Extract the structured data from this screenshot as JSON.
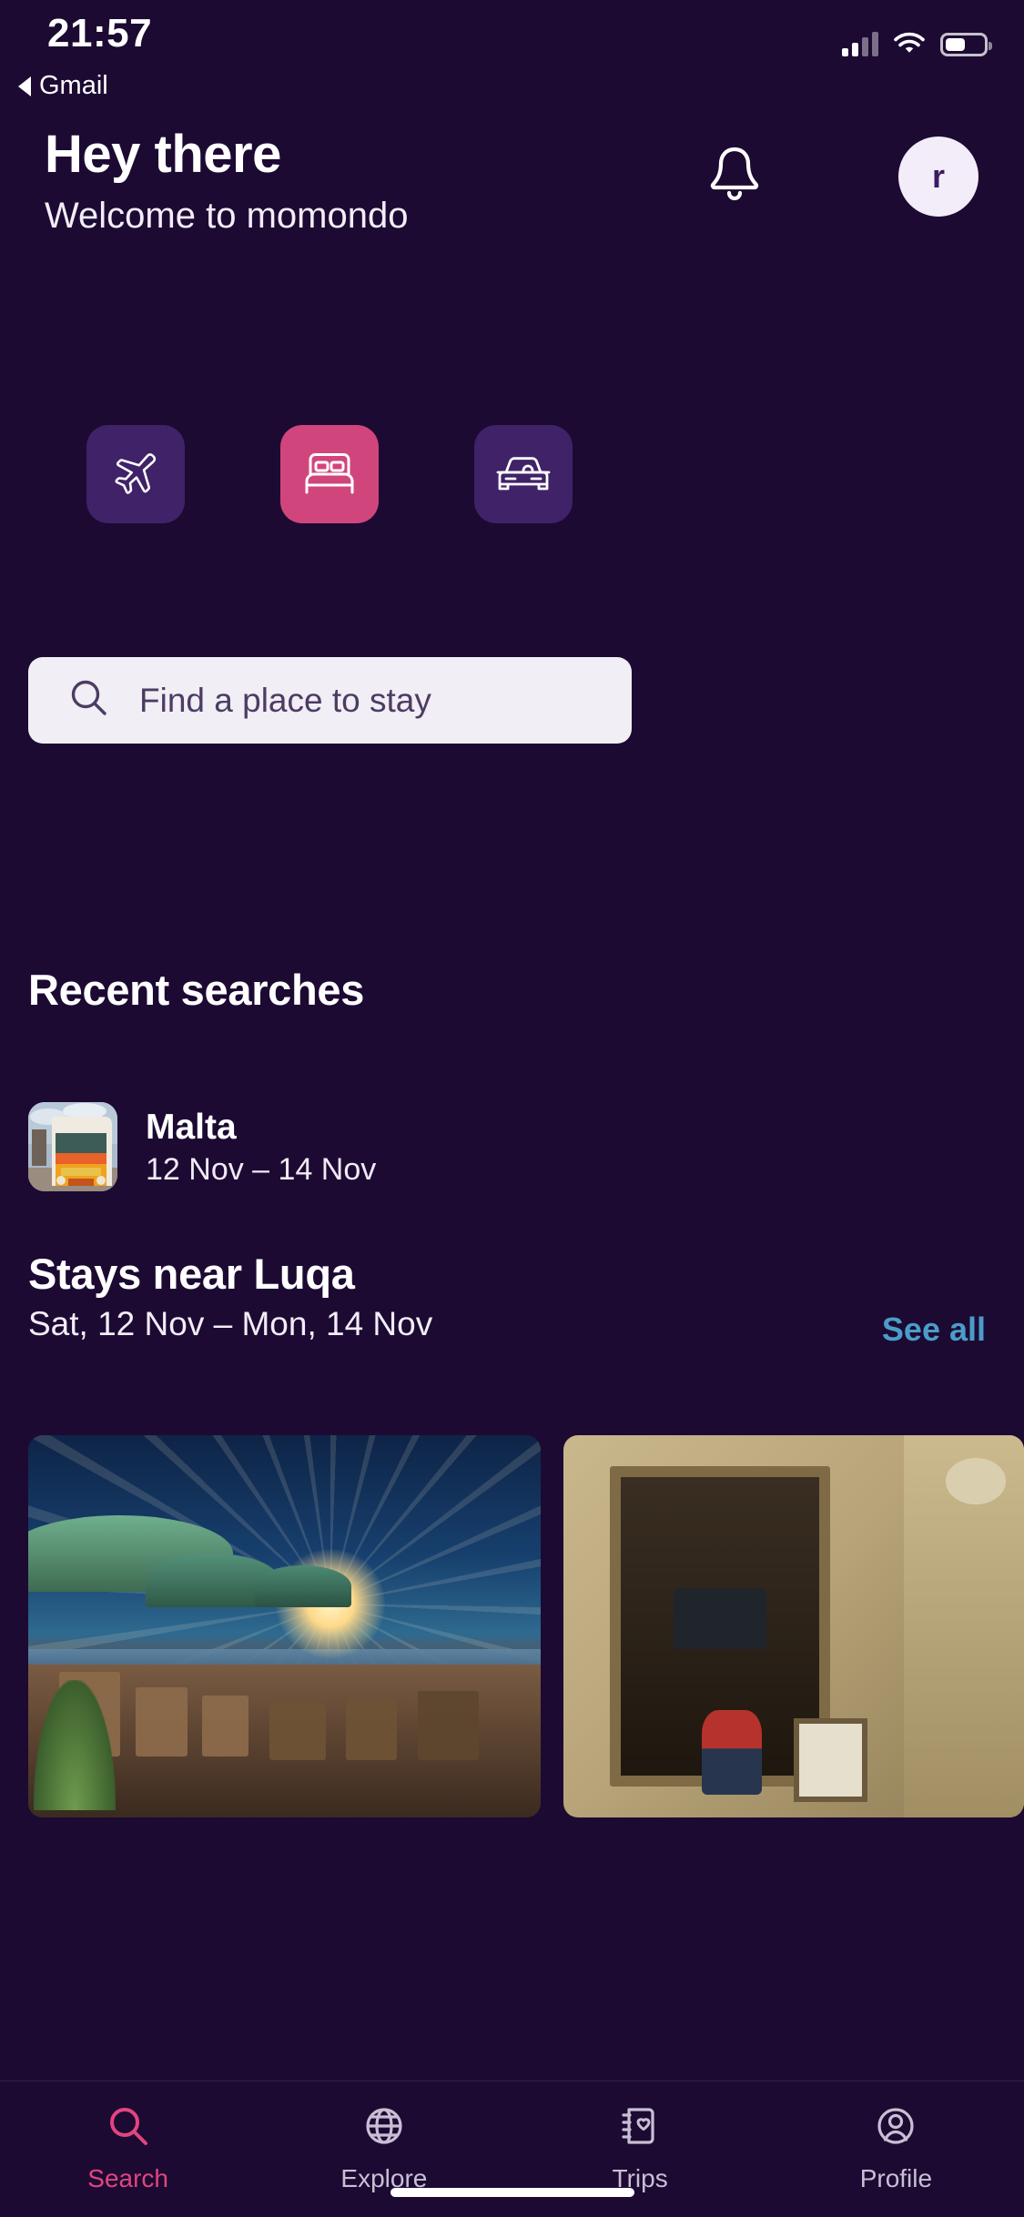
{
  "status_bar": {
    "time": "21:57",
    "back_label": "Gmail",
    "signal_icon": "signal-bars-icon",
    "wifi_icon": "wifi-icon",
    "battery_icon": "battery-icon"
  },
  "header": {
    "greeting_title": "Hey there",
    "greeting_subtitle": "Welcome to momondo",
    "notifications_icon": "bell-icon",
    "avatar_initial": "r"
  },
  "categories": [
    {
      "name": "flights",
      "icon": "airplane-icon",
      "color": "#3F2268",
      "selected": false
    },
    {
      "name": "stays",
      "icon": "bed-icon",
      "color": "#D1457D",
      "selected": true
    },
    {
      "name": "cars",
      "icon": "car-icon",
      "color": "#3F2268",
      "selected": false
    }
  ],
  "search": {
    "placeholder": "Find a place to stay",
    "icon": "search-icon",
    "value": ""
  },
  "recent_searches": {
    "title": "Recent searches",
    "items": [
      {
        "destination": "Malta",
        "dates": "12 Nov – 14 Nov",
        "thumbnail": "malta-bus-photo"
      }
    ]
  },
  "stays_near": {
    "title": "Stays near Luqa",
    "subtitle": "Sat, 12 Nov – Mon, 14 Nov",
    "see_all_label": "See all",
    "see_all_color": "#4B9CC9",
    "cards": [
      {
        "photo": "beach-bar-sunset-photo"
      },
      {
        "photo": "stone-interior-photo"
      }
    ]
  },
  "bottom_nav": {
    "items": [
      {
        "label": "Search",
        "icon": "search-icon",
        "active": true
      },
      {
        "label": "Explore",
        "icon": "globe-icon",
        "active": false
      },
      {
        "label": "Trips",
        "icon": "trips-icon",
        "active": false
      },
      {
        "label": "Profile",
        "icon": "profile-icon",
        "active": false
      }
    ],
    "active_color": "#E0457F",
    "inactive_color": "#C8BFD4"
  },
  "theme": {
    "background": "#1C0A33",
    "accent_pink": "#D1457D",
    "tile_purple": "#3F2268",
    "search_bg": "#F1EEF5"
  }
}
